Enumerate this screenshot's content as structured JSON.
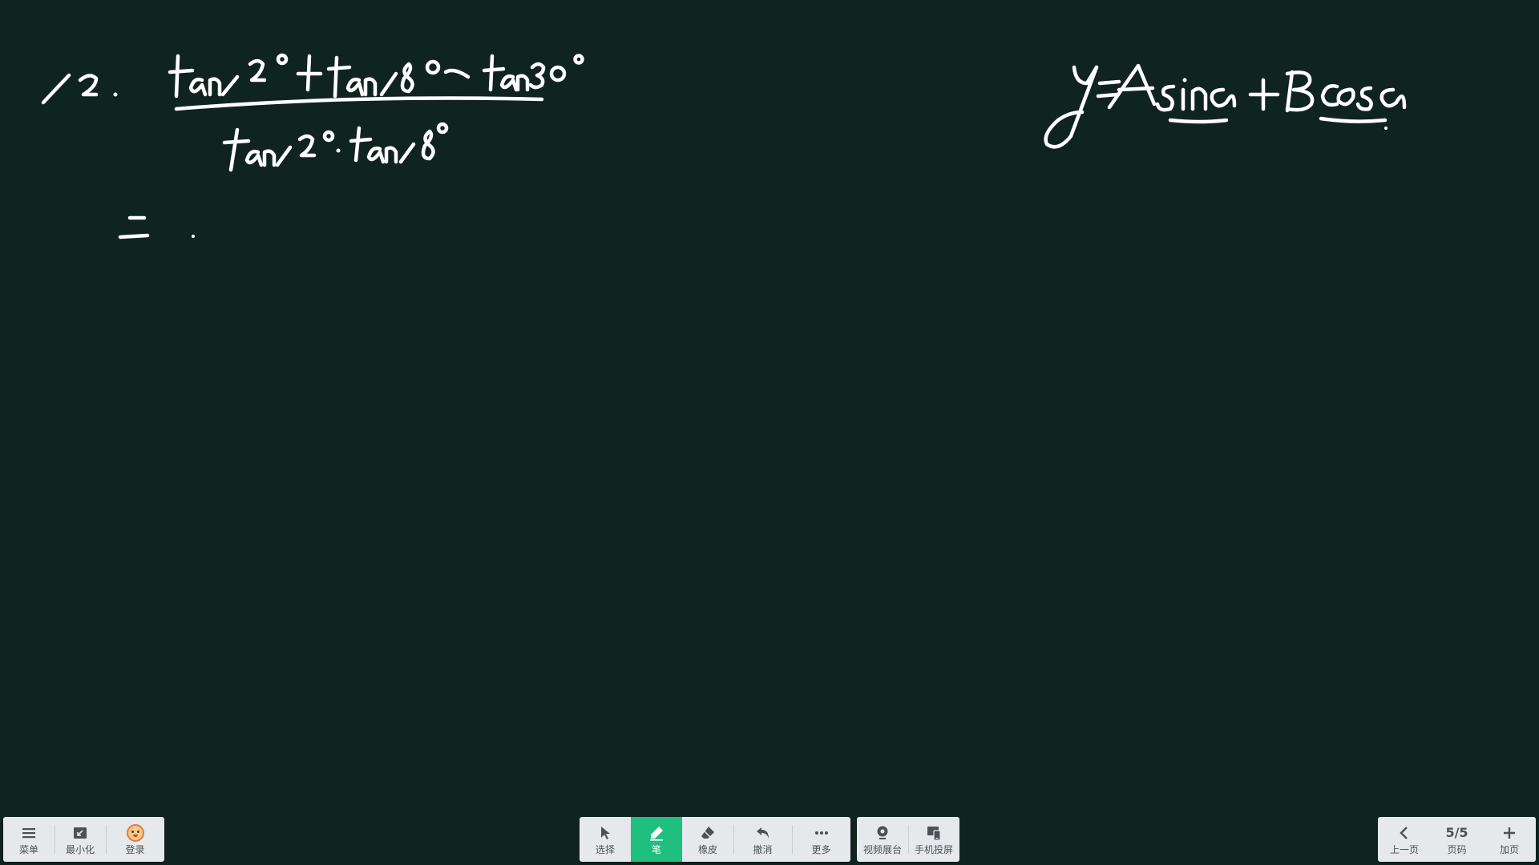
{
  "left_toolbar": {
    "menu": {
      "label": "菜单",
      "icon": "menu-icon"
    },
    "minimize": {
      "label": "最小化",
      "icon": "minimize-icon"
    },
    "login": {
      "label": "登录",
      "icon": "avatar-icon"
    }
  },
  "center_toolbar": {
    "select": {
      "label": "选择",
      "icon": "cursor-icon"
    },
    "pen": {
      "label": "笔",
      "icon": "pen-icon",
      "active": true
    },
    "eraser": {
      "label": "橡皮",
      "icon": "eraser-icon"
    },
    "undo": {
      "label": "撤消",
      "icon": "undo-icon"
    },
    "more": {
      "label": "更多",
      "icon": "more-icon"
    }
  },
  "share_toolbar": {
    "video_booth": {
      "label": "视频展台",
      "icon": "camera-icon"
    },
    "phone_cast": {
      "label": "手机投屏",
      "icon": "phone-cast-icon"
    }
  },
  "page_toolbar": {
    "prev": {
      "label": "上一页",
      "icon": "chevron-left-icon"
    },
    "page_indicator": {
      "value": "5/5",
      "label": "页码"
    },
    "add_page": {
      "label": "加页",
      "icon": "plus-icon"
    }
  },
  "colors": {
    "board_background": "#10241f",
    "ink": "#ffffff",
    "toolbar_background": "#e6e9ec",
    "active_accent": "#1fbf7f"
  }
}
